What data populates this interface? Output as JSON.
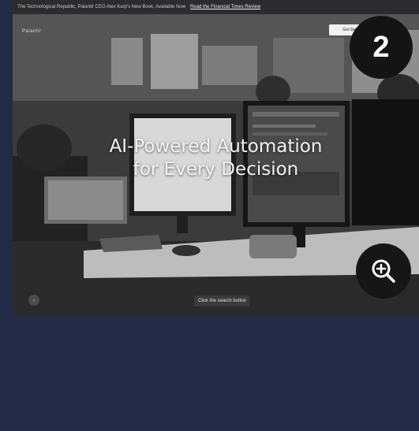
{
  "announcement": {
    "text": "The Technological Republic, Palantir CEO Alex Karp's New Book, Available Now",
    "link_label": "Read the Financial Times Review"
  },
  "nav": {
    "logo_text": "Palantir",
    "cta_label": "Get Started"
  },
  "hero": {
    "line1": "AI-Powered Automation",
    "line2": "for Every Decision"
  },
  "tooltip": {
    "text": "Click the search button"
  },
  "step_badge": {
    "number": "2"
  },
  "icons": {
    "zoom": "zoom-in-icon",
    "left_control": "chevron-icon"
  },
  "colors": {
    "page_background": "#232a45",
    "badge_background": "#141414"
  }
}
